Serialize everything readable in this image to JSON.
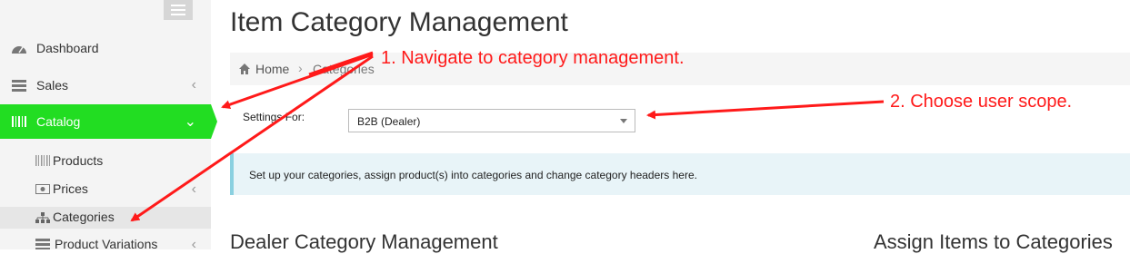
{
  "sidebar": {
    "items": [
      {
        "label": "Dashboard",
        "icon": "dashboard-icon"
      },
      {
        "label": "Sales",
        "icon": "sales-icon",
        "chevron": "‹"
      },
      {
        "label": "Catalog",
        "icon": "barcode-icon",
        "chevron": "⌄",
        "active": true
      }
    ],
    "sub_items": [
      {
        "label": "Products",
        "icon": "barcode-icon"
      },
      {
        "label": "Prices",
        "icon": "money-icon",
        "chevron": "‹"
      },
      {
        "label": "Categories",
        "icon": "sitemap-icon",
        "active": true
      },
      {
        "label": "Product Variations",
        "icon": "list-icon",
        "chevron": "‹"
      }
    ],
    "active_color": "#22dd22"
  },
  "page": {
    "title": "Item Category Management",
    "breadcrumb": {
      "home": "Home",
      "separator": "›",
      "current": "Categories"
    },
    "settings_label": "Settings For:",
    "settings_value": "B2B (Dealer)",
    "info_text": "Set up your categories, assign product(s) into categories and change category headers here.",
    "section_left": "Dealer Category Management",
    "section_right": "Assign Items to Categories"
  },
  "annotations": {
    "step1": "1. Navigate to category management.",
    "step2": "2. Choose user scope.",
    "color": "#ff1a1a"
  }
}
